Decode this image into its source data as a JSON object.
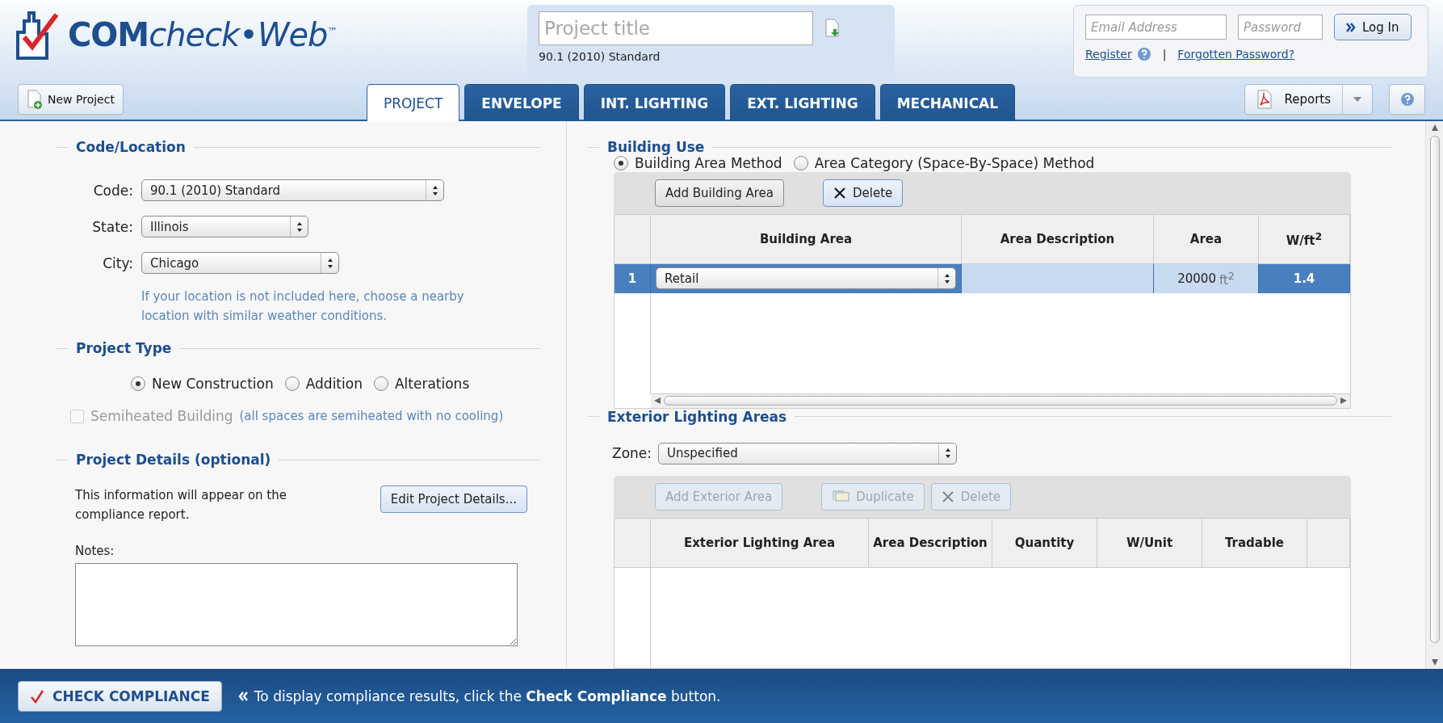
{
  "logo": {
    "strong": "COM",
    "rest": "check•Web",
    "mark": "™"
  },
  "project": {
    "title_placeholder": "Project title",
    "code": "90.1 (2010) Standard"
  },
  "login": {
    "email_placeholder": "Email Address",
    "password_placeholder": "Password",
    "button": "Log In",
    "register": "Register",
    "separator": "|",
    "forgot": "Forgotten Password?"
  },
  "toolbar": {
    "new_project": "New Project",
    "reports": "Reports"
  },
  "tabs": [
    {
      "label": "PROJECT",
      "selected": true
    },
    {
      "label": "ENVELOPE",
      "selected": false
    },
    {
      "label": "INT. LIGHTING",
      "selected": false
    },
    {
      "label": "EXT. LIGHTING",
      "selected": false
    },
    {
      "label": "MECHANICAL",
      "selected": false
    }
  ],
  "code_location": {
    "title": "Code/Location",
    "fields": [
      {
        "label": "Code:",
        "value": "90.1 (2010) Standard"
      },
      {
        "label": "State:",
        "value": "Illinois"
      },
      {
        "label": "City:",
        "value": "Chicago"
      }
    ],
    "hint": "If your location is not included here, choose a nearby location with similar weather conditions."
  },
  "project_type": {
    "title": "Project Type",
    "options": [
      {
        "label": "New Construction",
        "selected": true
      },
      {
        "label": "Addition",
        "selected": false
      },
      {
        "label": "Alterations",
        "selected": false
      }
    ],
    "semiheated": {
      "label": "Semiheated Building",
      "note": "(all spaces are semiheated with no cooling)",
      "checked": false,
      "disabled": true
    }
  },
  "project_details": {
    "title": "Project Details (optional)",
    "text": "This information will appear on the compliance report.",
    "button": "Edit Project Details...",
    "notes_label": "Notes:"
  },
  "building_use": {
    "title": "Building Use",
    "methods": [
      {
        "label": "Building Area Method",
        "selected": true
      },
      {
        "label": "Area Category (Space-By-Space) Method",
        "selected": false
      }
    ],
    "actions": [
      {
        "label": "Add Building Area",
        "kind": "plain",
        "disabled": false
      },
      {
        "label": "Delete",
        "kind": "delete",
        "disabled": false
      }
    ],
    "columns": [
      "Building Area",
      "Area Description",
      "Area",
      "W/ft$^{2}$"
    ],
    "rows": [
      {
        "index": "1",
        "building_area": "Retail",
        "area": "20000",
        "unit": "ft$^{2}$",
        "watts": "1.4",
        "selected": true
      }
    ]
  },
  "exterior_lighting": {
    "title": "Exterior Lighting Areas",
    "zone_label": "Zone:",
    "zone": "Unspecified",
    "actions": [
      {
        "label": "Add Exterior Area",
        "kind": "plain",
        "disabled": true
      },
      {
        "label": "Duplicate",
        "kind": "duplicate",
        "disabled": true
      },
      {
        "label": "Delete",
        "kind": "delete",
        "disabled": true
      }
    ],
    "columns": [
      "Exterior Lighting Area",
      "Area Description",
      "Quantity",
      "W/Unit",
      "Tradable"
    ]
  },
  "footer": {
    "button": "CHECK COMPLIANCE",
    "message": "To display compliance results, click the **Check Compliance** button."
  }
}
